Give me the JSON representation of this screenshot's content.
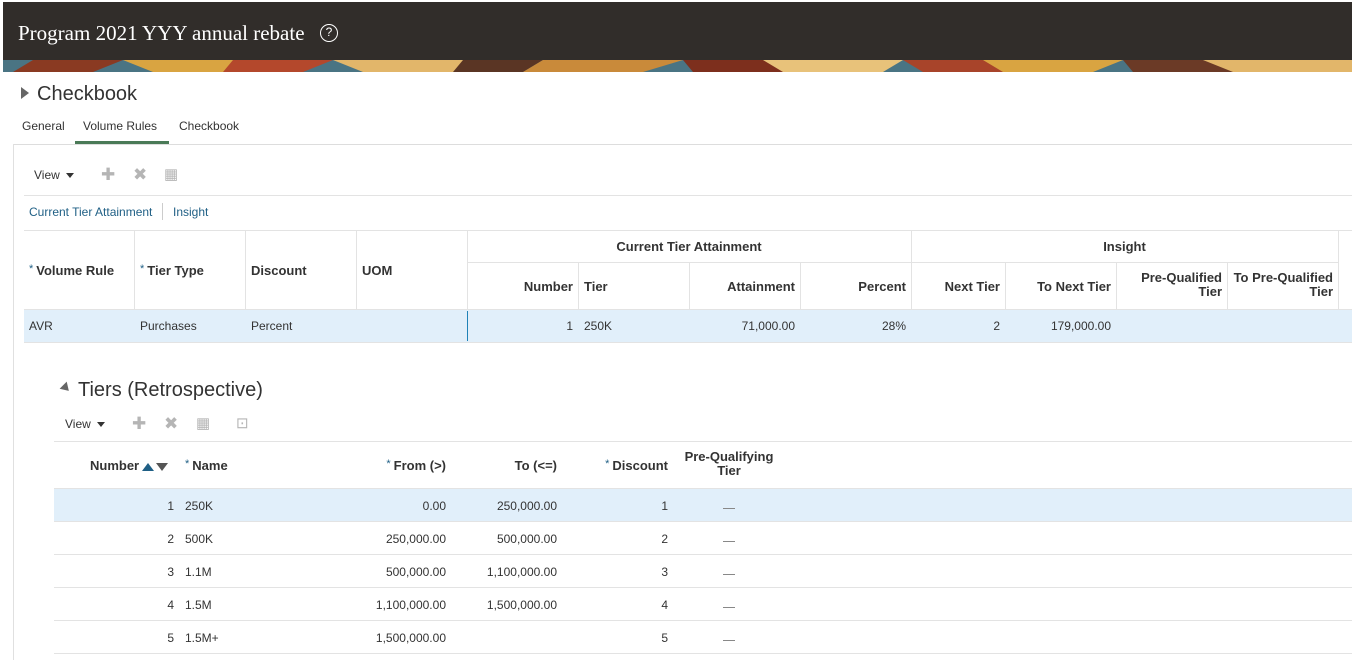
{
  "header": {
    "title": "Program 2021 YYY annual rebate"
  },
  "section": {
    "title": "Checkbook"
  },
  "tabs": [
    {
      "label": "General"
    },
    {
      "label": "Volume Rules"
    },
    {
      "label": "Checkbook"
    }
  ],
  "toolbar": {
    "view_label": "View"
  },
  "column_groups": [
    {
      "label": "Current Tier Attainment"
    },
    {
      "label": "Insight"
    }
  ],
  "main_table": {
    "group_headers": [
      "Current Tier Attainment",
      "Insight"
    ],
    "columns": [
      "Volume Rule",
      "Tier Type",
      "Discount",
      "UOM",
      "Number",
      "Tier",
      "Attainment",
      "Percent",
      "Next Tier",
      "To Next Tier",
      "Pre-Qualified Tier",
      "To Pre-Qualified Tier"
    ],
    "rows": [
      [
        "AVR",
        "Purchases",
        "Percent",
        "",
        "1",
        "250K",
        "71,000.00",
        "28%",
        "2",
        "179,000.00",
        "",
        ""
      ]
    ]
  },
  "tiers": {
    "title": "Tiers (Retrospective)",
    "view_label": "View",
    "columns": [
      "Number",
      "Name",
      "From (>)",
      "To (<=)",
      "Discount",
      "Pre-Qualifying Tier"
    ],
    "rows": [
      [
        "1",
        "250K",
        "0.00",
        "250,000.00",
        "1"
      ],
      [
        "2",
        "500K",
        "250,000.00",
        "500,000.00",
        "2"
      ],
      [
        "3",
        "1.1M",
        "500,000.00",
        "1,100,000.00",
        "3"
      ],
      [
        "4",
        "1.5M",
        "1,100,000.00",
        "1,500,000.00",
        "4"
      ],
      [
        "5",
        "1.5M+",
        "1,500,000.00",
        "",
        "5"
      ]
    ]
  },
  "colors": {
    "header_bg": "#312d2a",
    "accent_green": "#4a7a57",
    "link_blue": "#1f5f85",
    "row_highlight": "#e1effa"
  }
}
